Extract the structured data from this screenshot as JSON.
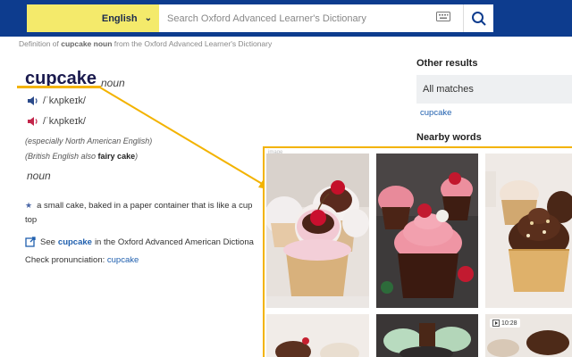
{
  "header": {
    "language": "English",
    "search_placeholder": "Search Oxford Advanced Learner's Dictionary"
  },
  "definition_line": {
    "prefix": "Definition of",
    "term": "cupcake noun",
    "suffix": "from the Oxford Advanced Learner's Dictionary"
  },
  "entry": {
    "headword": "cupcake",
    "pos": "noun",
    "pron_uk": "/ˈkʌpkeɪk/",
    "pron_us": "/ˈkʌpkeɪk/",
    "region_note": "(especially North American English)",
    "british_prefix": "(British English also",
    "british_term": "fairy cake",
    "british_suffix": ")",
    "pos2": "noun",
    "sense": "a small cake, baked in a paper container that is like a cup",
    "sense_cont": "top",
    "see_prefix": "See",
    "see_term": "cupcake",
    "see_suffix": "in the Oxford Advanced American Dictiona",
    "check_label": "Check pronunciation:",
    "check_term": "cupcake"
  },
  "sidebar": {
    "other_results": "Other results",
    "all_matches": "All matches",
    "result_link": "cupcake",
    "nearby_words": "Nearby words"
  },
  "image_panel": {
    "tag": "image",
    "video_duration": "10:28"
  },
  "colors": {
    "header_blue": "#0d3c8e",
    "language_yellow": "#f4ea6b",
    "highlight": "#f3b300",
    "link": "#1f5fae"
  }
}
